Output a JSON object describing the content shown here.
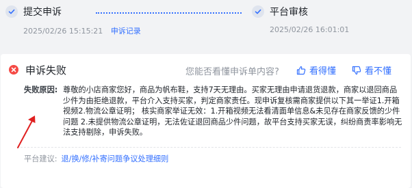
{
  "timeline": {
    "steps": [
      {
        "title": "提交申诉",
        "time": "2025/02/26 15:15:21",
        "link": "申诉记录"
      },
      {
        "title": "平台审核",
        "time": "2025/02/26 16:01:01"
      }
    ]
  },
  "result": {
    "title": "申诉失败",
    "helpful_question": "您能否看懂申诉单内容?",
    "understood_label": "看得懂",
    "not_understood_label": "看不懂",
    "reason_label": "失败原因:",
    "reason_text": "尊敬的小店商家您好，商品为帆布鞋，支持7天无理由。买家无理由申请退货退款，商家以退回商品少件为由拒绝退款，平台介入支持买家，判定商家责任。现申诉复核需商家提供以下其一举证1.开箱视频2.物流公章证明；  核实商家举证无效：1.开箱视频无法看清面单信息&未见存在商家反馈的少件问题 2.未提供物流公章证明，无法佐证退回商品少件问题，故平台支持买家无误，纠纷商责率影响无法支持剔除，申诉失败。",
    "suggestion_label": "平台建议:",
    "suggestion_link": "退/换/修/补寄问题争议处理细则"
  },
  "colors": {
    "accent": "#3370ff",
    "danger": "#f54a45",
    "annotation_arrow": "#e02020"
  },
  "icons": {
    "step_done": "check-icon",
    "fail": "close-circle-icon",
    "understood": "thumbs-up-icon",
    "not_understood": "thumbs-down-icon"
  }
}
